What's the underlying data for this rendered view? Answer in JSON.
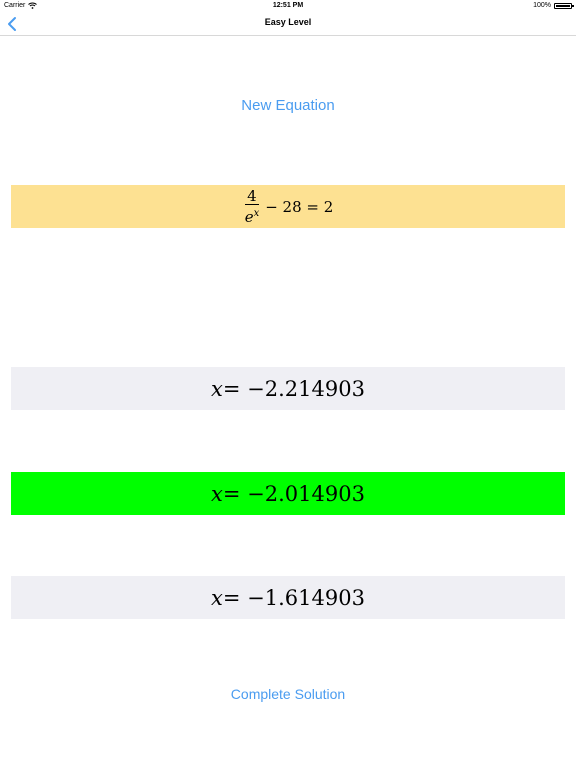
{
  "status_bar": {
    "carrier": "Carrier",
    "time": "12:51 PM",
    "battery": "100%"
  },
  "nav": {
    "title": "Easy Level",
    "back_icon": "chevron-left-icon"
  },
  "new_equation_label": "New Equation",
  "equation": {
    "numerator": "4",
    "denominator_base": "e",
    "denominator_exp": "x",
    "rest": "− 28 = 2"
  },
  "answers": [
    {
      "var": "x",
      "text": " = −2.214903"
    },
    {
      "var": "x",
      "text": " = −2.014903"
    },
    {
      "var": "x",
      "text": " = −1.614903"
    }
  ],
  "colors": {
    "accent": "#4a9cf0",
    "equation_bg": "#fde192",
    "answer_bg": "#efeff4",
    "correct_bg": "#00ff00"
  },
  "complete_solution_label": "Complete Solution"
}
